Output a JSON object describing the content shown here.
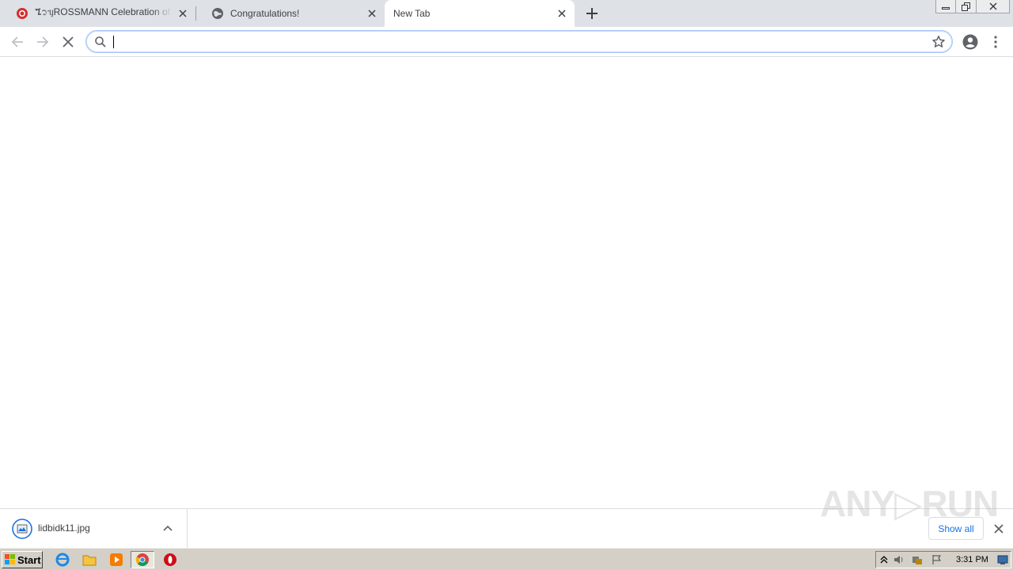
{
  "tabs": [
    {
      "title": "ጜ᭡ᥡROSSMANN Celebration of t",
      "icon": "rossmann-favicon",
      "active": false
    },
    {
      "title": "Congratulations!",
      "icon": "globe-icon",
      "active": false
    },
    {
      "title": "New Tab",
      "icon": "",
      "active": true
    }
  ],
  "omnibox": {
    "value": "",
    "placeholder": ""
  },
  "download": {
    "filename": "lidbidk11.jpg",
    "show_all_label": "Show all"
  },
  "watermark": {
    "left": "ANY",
    "right": "RUN"
  },
  "taskbar": {
    "start_label": "Start",
    "clock": "3:31 PM"
  },
  "colors": {
    "tabstrip": "#dee1e6",
    "accent": "#1a73e8",
    "taskbar": "#d4d0c8"
  }
}
